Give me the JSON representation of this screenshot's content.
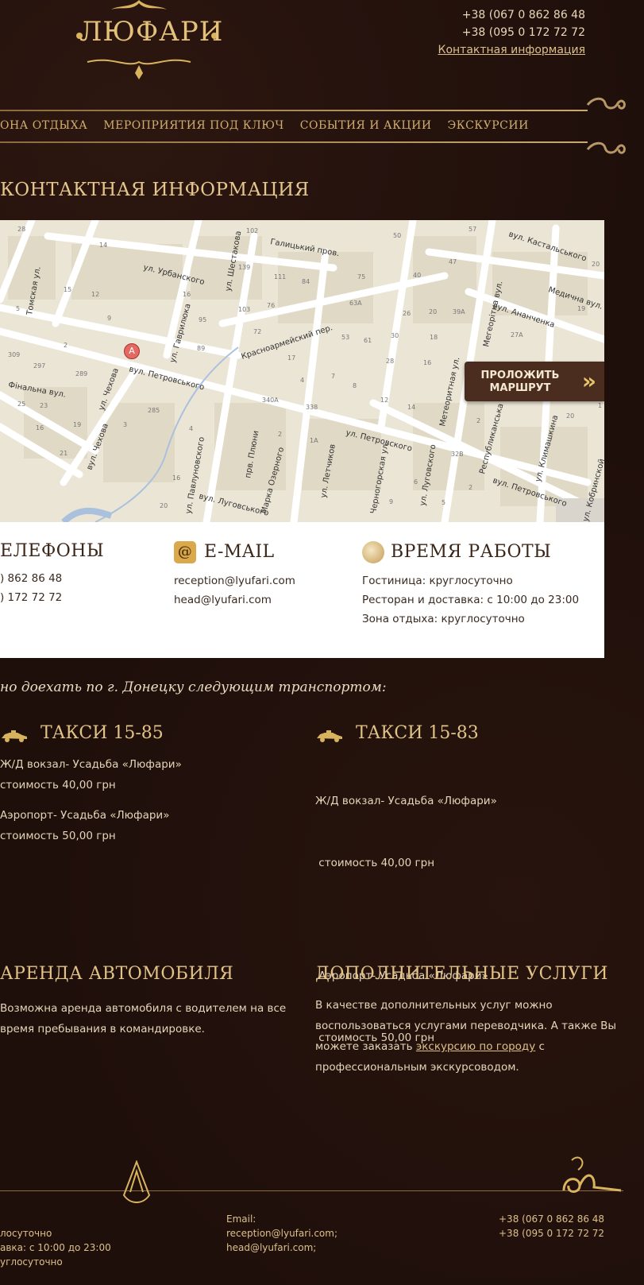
{
  "header": {
    "logo_text": "ЛЮФАРИ",
    "phones": [
      "+38 (067 0 862 86 48",
      "+38 (095 0 172 72 72"
    ],
    "contact_link": "Контактная информация"
  },
  "nav": {
    "items": [
      "ОНА ОТДЫХА",
      "МЕРОПРИЯТИЯ ПОД КЛЮЧ",
      "СОБЫТИЯ И АКЦИИ",
      "ЭКСКУРСИИ"
    ]
  },
  "page_title": "КОНТАКТНАЯ ИНФОРМАЦИЯ",
  "map": {
    "route_button": [
      "ПРОЛОЖИТЬ",
      "МАРШРУТ"
    ],
    "marker": "A",
    "streets": [
      "вул. Кастальського",
      "Галицький пров.",
      "ул. Урбанского",
      "ул. Шестакова",
      "вул. Ананченка",
      "Медична вул.",
      "Красноармейский пер.",
      "вул. Петровського",
      "ул. Петровского",
      "Фінальна вул.",
      "ул. Чехова",
      "вул. Чехова",
      "Томская ул.",
      "ул. Гаврилюка",
      "ул. Павлуновского",
      "вул. Луговського",
      "Марка Озерного",
      "ул. Летчиков",
      "Черногорская ул.",
      "ул. Луговского",
      "Республиканська вул.",
      "ул. Климашкина",
      "вул. Петровського",
      "ул. Кобринской",
      "Метеоритная ул.",
      "Мегеорітна вул.",
      "прв. Плюни"
    ]
  },
  "contacts": {
    "phones_title": "ЕЛЕФОНЫ",
    "phones": [
      ") 862 86 48",
      ") 172 72 72"
    ],
    "email_title": "E-MAIL",
    "emails": [
      "reception@lyufari.com",
      "head@lyufari.com"
    ],
    "hours_title": "ВРЕМЯ РАБОТЫ",
    "hours": [
      "Гостиница: круглосуточно",
      "Ресторан и доставка: с 10:00 до 23:00",
      "Зона отдыха: круглосуточно"
    ]
  },
  "intro": "но доехать по г. Донецку следующим транспортом:",
  "taxi": [
    {
      "title": "ТАКСИ 15-85",
      "lines": [
        "Ж/Д вокзал- Усадьба «Люфари»",
        "стоимость 40,00 грн",
        "Аэропорт- Усадьба «Люфари»",
        "стоимость 50,00 грн"
      ]
    },
    {
      "title": "ТАКСИ 15-83",
      "lines": [
        "Ж/Д вокзал- Усадьба «Люфари»",
        " стоимость 40,00 грн",
        " Аэропорт- Усадьба «Люфари»",
        " стоимость 50,00 грн"
      ]
    }
  ],
  "car_rental": {
    "title": "АРЕНДА АВТОМОБИЛЯ",
    "text_lines": [
      "Возможна аренда автомобиля с водителем на все",
      "время пребывания  в командировке."
    ]
  },
  "extra": {
    "title": "ДОПОЛНИТЕЛЬНЫЕ УСЛУГИ",
    "line1": "В качестве дополнительных услуг можно",
    "line2": "воспользоваться услугами переводчика. А также Вы",
    "line3_pre": "можете заказать ",
    "line3_link": "экскурсию по городу",
    "line3_post": " с",
    "line4": "профессиональным экскурсоводом."
  },
  "footer": {
    "hours": [
      "лосуточно",
      "авка: с 10:00 до 23:00",
      "углосуточно"
    ],
    "email_label": "Email:",
    "emails": [
      "reception@lyufari.com;",
      "head@lyufari.com;"
    ],
    "phones": [
      "+38 (067 0 862 86 48",
      "+38 (095 0 172 72 72"
    ]
  },
  "colors": {
    "background": "#1f0f0b",
    "gold": "#dcc08a",
    "panel": "#ffffff",
    "button": "#4a2d1e"
  }
}
